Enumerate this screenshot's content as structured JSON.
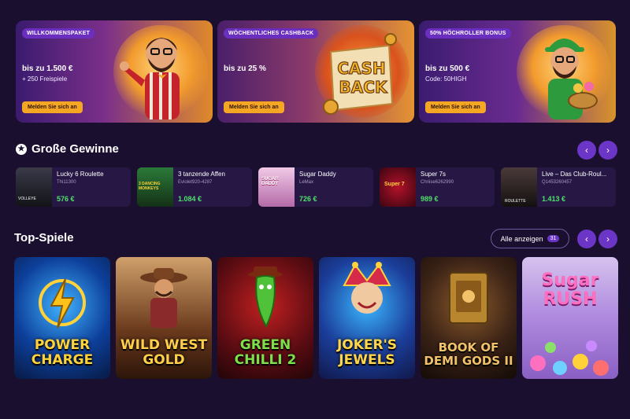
{
  "promos": [
    {
      "tag": "WILLKOMMENSPAKET",
      "line1": "bis zu 1.500 €",
      "line2": "+ 250 Freispiele",
      "cta": "Melden Sie sich an"
    },
    {
      "tag": "WÖCHENTLICHES CASHBACK",
      "line1": "bis zu 25 %",
      "line2": "",
      "cta": "Melden Sie sich an",
      "art_text": "CASH BACK"
    },
    {
      "tag": "50% HÖCHROLLER BONUS",
      "line1": "bis zu 500 €",
      "line2": "Code: 50HIGH",
      "cta": "Melden Sie sich an"
    }
  ],
  "big_wins": {
    "title": "Große Gewinne",
    "items": [
      {
        "game": "Lucky 6 Roulette",
        "user": "Thi11300",
        "amount": "576 €",
        "thumb_label": "VOLLEYE"
      },
      {
        "game": "3 tanzende Affen",
        "user": "Eviolet920-4287",
        "amount": "1.084 €",
        "thumb_label": "3 DANCING MONKEYS"
      },
      {
        "game": "Sugar Daddy",
        "user": "LeMax",
        "amount": "726 €",
        "thumb_label": "SUGAR DADDY"
      },
      {
        "game": "Super 7s",
        "user": "Chriise6262990",
        "amount": "989 €",
        "thumb_label": "Super 7"
      },
      {
        "game": "Live – Das Club-Roul...",
        "user": "Q1453260457",
        "amount": "1.413 €",
        "thumb_label": "ROULETTE"
      }
    ]
  },
  "top_games": {
    "title": "Top-Spiele",
    "see_all": "Alle anzeigen",
    "count": "31",
    "items": [
      {
        "title": "POWER CHARGE",
        "color": "#ffd23a"
      },
      {
        "title": "WILD WEST GOLD",
        "color": "#ffcf4a"
      },
      {
        "title": "GREEN CHILLI 2",
        "color": "#7de04a"
      },
      {
        "title": "JOKER'S JEWELS",
        "color": "#ffd54a"
      },
      {
        "title": "BOOK OF DEMI GODS II",
        "color": "#f2c26a"
      },
      {
        "title": "Sugar RUSH",
        "color": "#ff6fc0"
      }
    ]
  },
  "icons": {
    "prev": "chevron-left-icon",
    "next": "chevron-right-icon",
    "star": "star-icon"
  }
}
